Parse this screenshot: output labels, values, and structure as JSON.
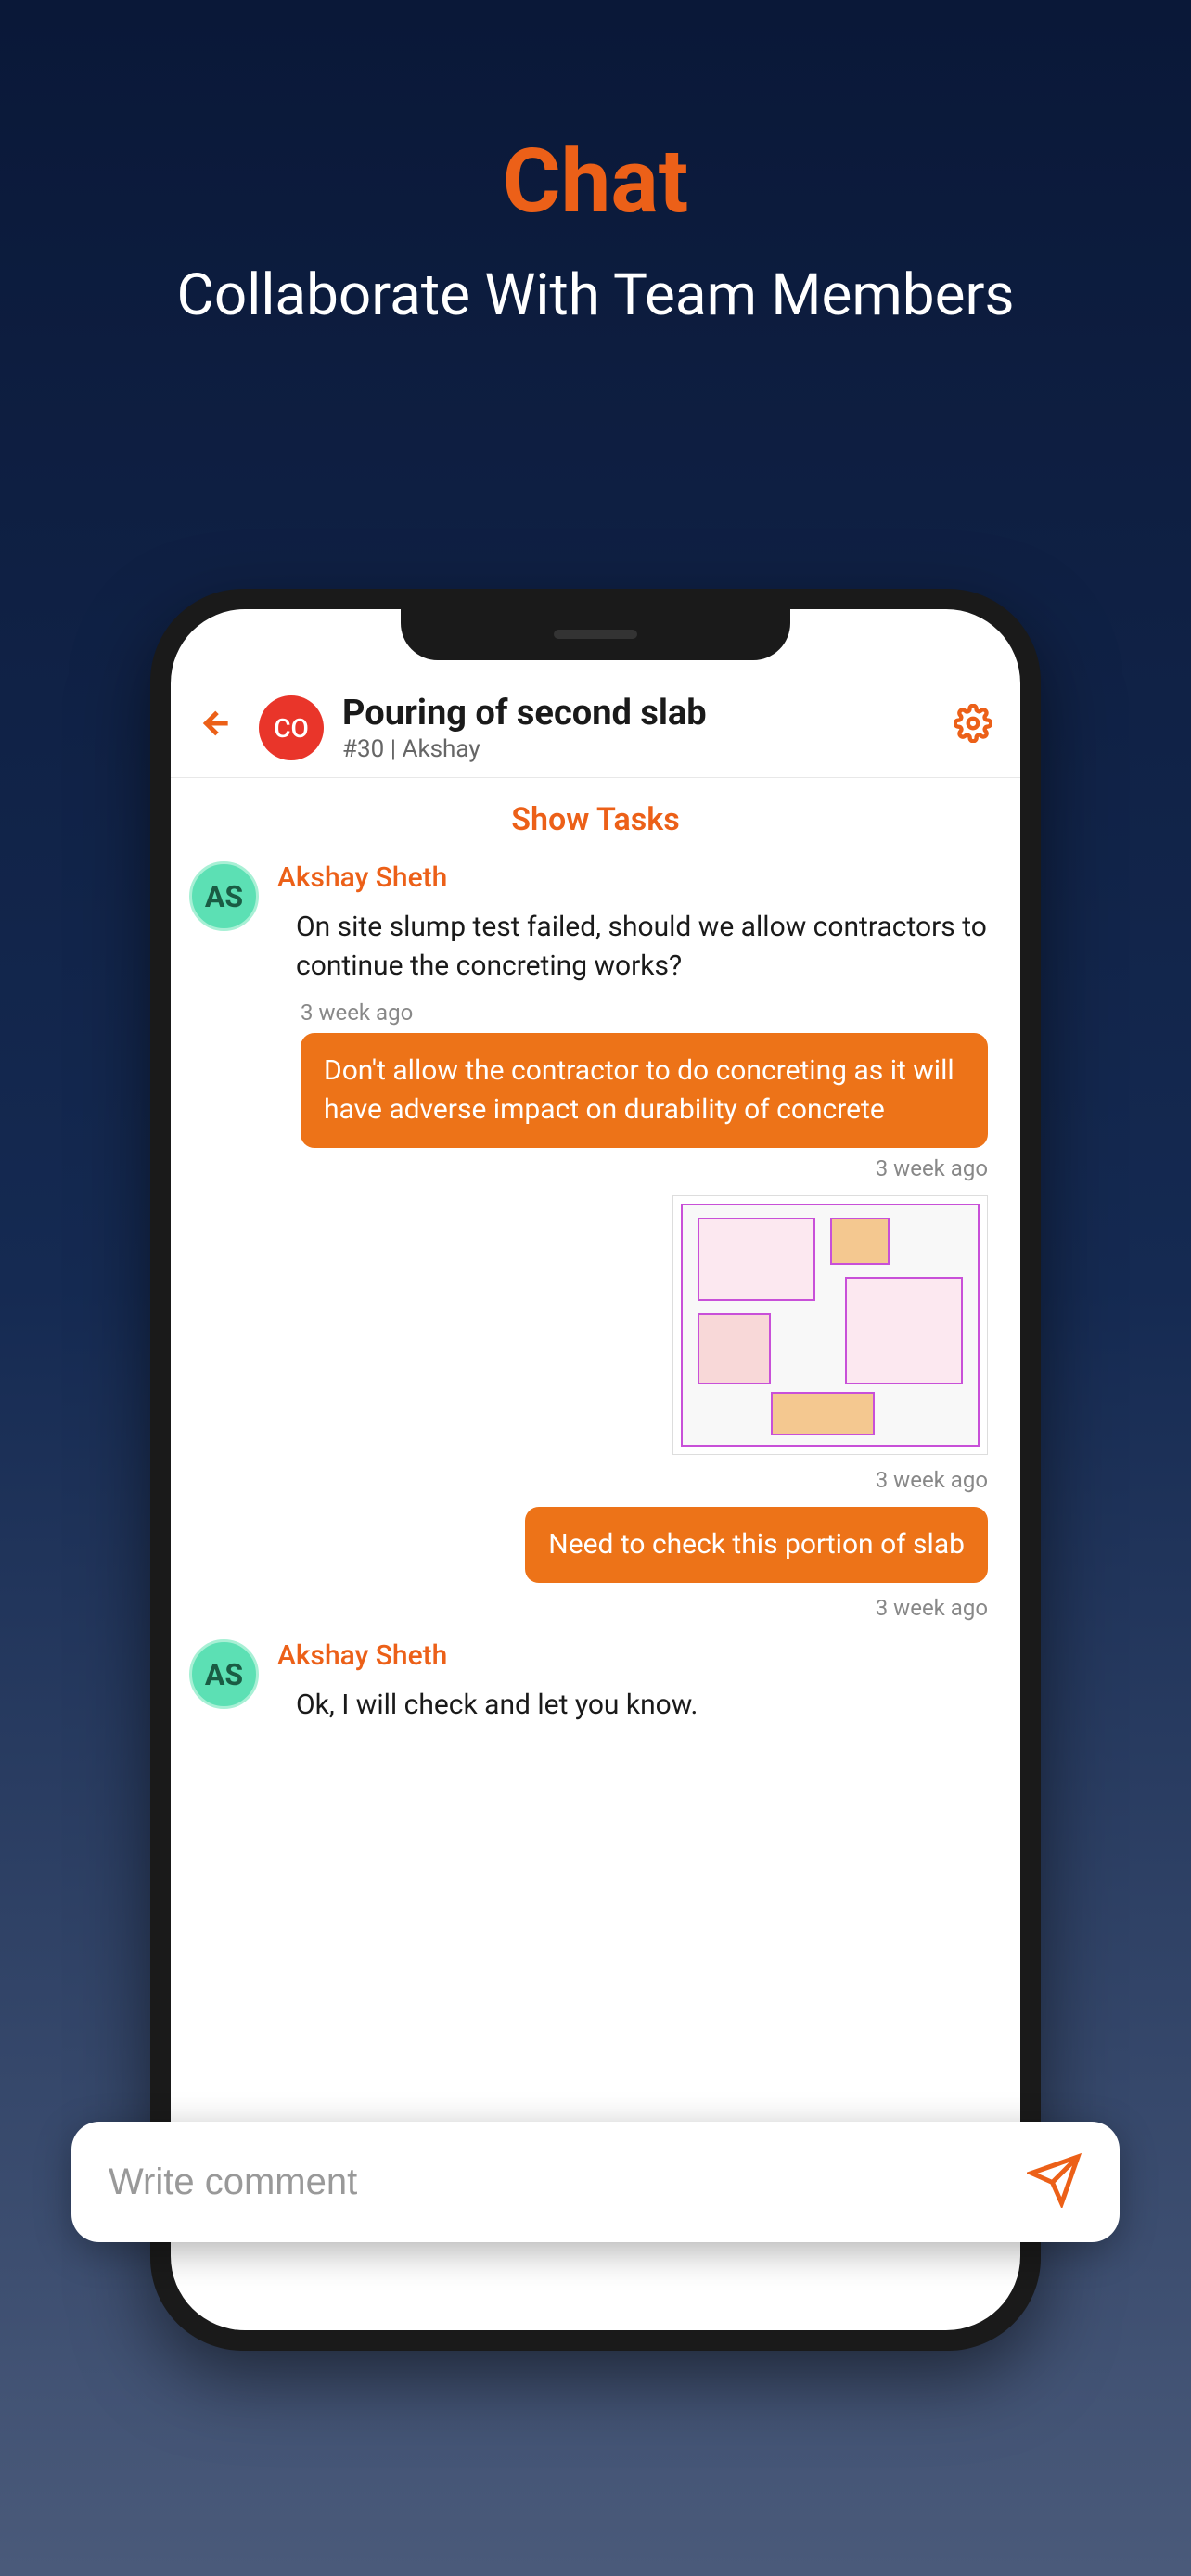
{
  "marketing": {
    "title": "Chat",
    "subtitle": "Collaborate With Team Members"
  },
  "header": {
    "avatar_initials": "CO",
    "title": "Pouring of second slab",
    "task_id": "#30",
    "separator": "|",
    "assignee": "Akshay"
  },
  "show_tasks_label": "Show Tasks",
  "messages": [
    {
      "type": "received",
      "avatar_initials": "AS",
      "sender_name": "Akshay Sheth",
      "text": "On site slump test failed, should we allow contractors to continue the concreting works?",
      "timestamp": "3 week ago"
    },
    {
      "type": "sent",
      "text": "Don't allow the contractor to do concreting as it will have adverse impact on durability of concrete",
      "timestamp": "3 week ago"
    },
    {
      "type": "sent_image",
      "image_description": "floor-plan-blueprint",
      "timestamp": "3 week ago"
    },
    {
      "type": "sent",
      "text": "Need to check this portion of slab",
      "timestamp": "3 week ago"
    },
    {
      "type": "received",
      "avatar_initials": "AS",
      "sender_name": "Akshay Sheth",
      "text": "Ok, I will check and let you know."
    }
  ],
  "input": {
    "placeholder": "Write comment"
  },
  "colors": {
    "accent": "#ec6018",
    "bubble": "#ed7318"
  }
}
